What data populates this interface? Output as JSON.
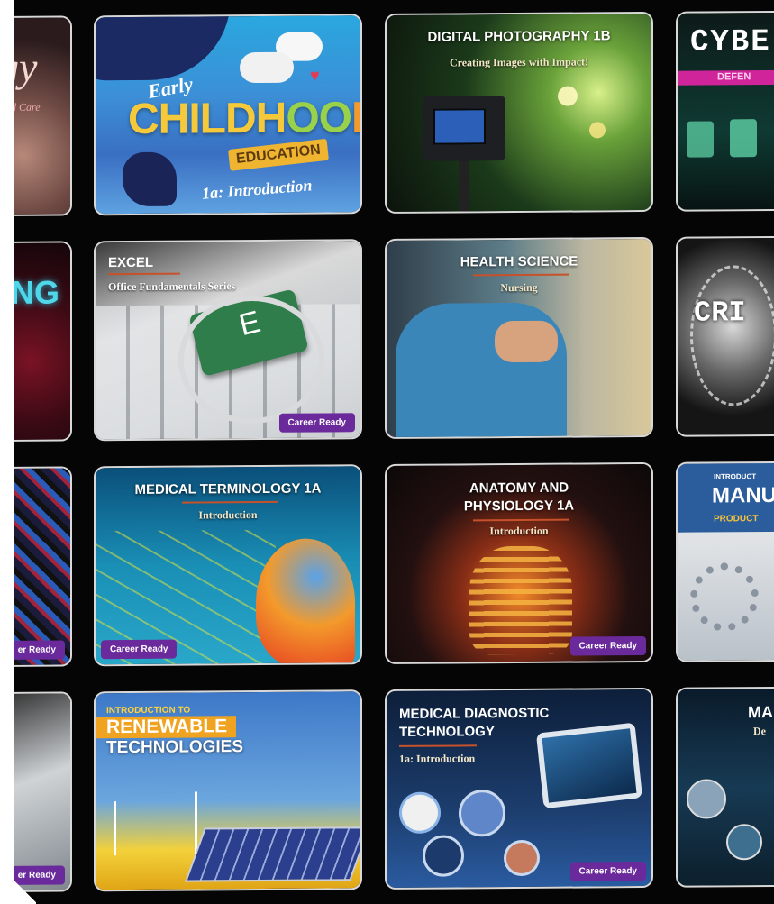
{
  "gallery": {
    "row1": {
      "left_partial": {
        "title": "gy",
        "sub": "d Care"
      },
      "childhood": {
        "early": "Early",
        "title": "CHILDH",
        "title_oo": "OO",
        "title_end": "D",
        "ribbon": "EDUCATION",
        "sub": "1a: Introduction"
      },
      "photo": {
        "title": "DIGITAL PHOTOGRAPHY 1B",
        "sub": "Creating Images with Impact!"
      },
      "cyber": {
        "title": "CYBE",
        "sub": "DEFEN"
      }
    },
    "row2": {
      "left_partial": {
        "title": "NG"
      },
      "excel": {
        "title": "EXCEL",
        "sub": "Office Fundamentals Series",
        "key": "E",
        "badge": "Career Ready"
      },
      "health": {
        "title": "HEALTH SCIENCE",
        "sub": "Nursing"
      },
      "crim": {
        "title": "CRI"
      }
    },
    "row3": {
      "left_partial": {
        "badge": "er Ready"
      },
      "medterm": {
        "title": "MEDICAL TERMINOLOGY 1A",
        "sub": "Introduction",
        "badge": "Career Ready"
      },
      "anatomy": {
        "title_l1": "ANATOMY AND",
        "title_l2": "PHYSIOLOGY 1A",
        "sub": "Introduction",
        "badge": "Career Ready"
      },
      "manu": {
        "pre": "INTRODUCT",
        "title": "MANU",
        "sub": "PRODUCT"
      }
    },
    "row4": {
      "left_partial": {
        "badge": "er Ready"
      },
      "renew": {
        "pre": "INTRODUCTION TO",
        "title_l1": "RENEWABLE",
        "title_l2": "TECHNOLOGIES"
      },
      "meddiag": {
        "title_l1": "MEDICAL DIAGNOSTIC",
        "title_l2": "TECHNOLOGY",
        "sub": "1a: Introduction",
        "badge": "Career Ready"
      },
      "right_partial": {
        "title": "MA",
        "sub": "De"
      }
    }
  }
}
